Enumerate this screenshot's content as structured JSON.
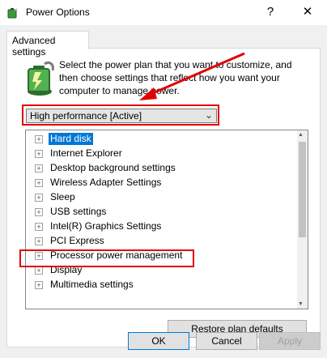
{
  "window": {
    "title": "Power Options",
    "help_glyph": "?",
    "close_glyph": "✕",
    "icon": "power-options-icon"
  },
  "tab": {
    "label": "Advanced settings"
  },
  "description": "Select the power plan that you want to customize, and then choose settings that reflect how you want your computer to manage power.",
  "plan_select": {
    "value": "High performance [Active]",
    "arrow_icon": "chevron-down-icon"
  },
  "tree": {
    "items": [
      {
        "label": "Hard disk",
        "selected": true
      },
      {
        "label": "Internet Explorer"
      },
      {
        "label": "Desktop background settings"
      },
      {
        "label": "Wireless Adapter Settings"
      },
      {
        "label": "Sleep"
      },
      {
        "label": "USB settings"
      },
      {
        "label": "Intel(R) Graphics Settings"
      },
      {
        "label": "PCI Express"
      },
      {
        "label": "Processor power management"
      },
      {
        "label": "Display"
      },
      {
        "label": "Multimedia settings"
      }
    ],
    "expander_glyph": "+"
  },
  "buttons": {
    "restore": "Restore plan defaults",
    "ok": "OK",
    "cancel": "Cancel",
    "apply": "Apply"
  },
  "colors": {
    "annotation_red": "#e00000",
    "selection_blue": "#0078d7"
  }
}
